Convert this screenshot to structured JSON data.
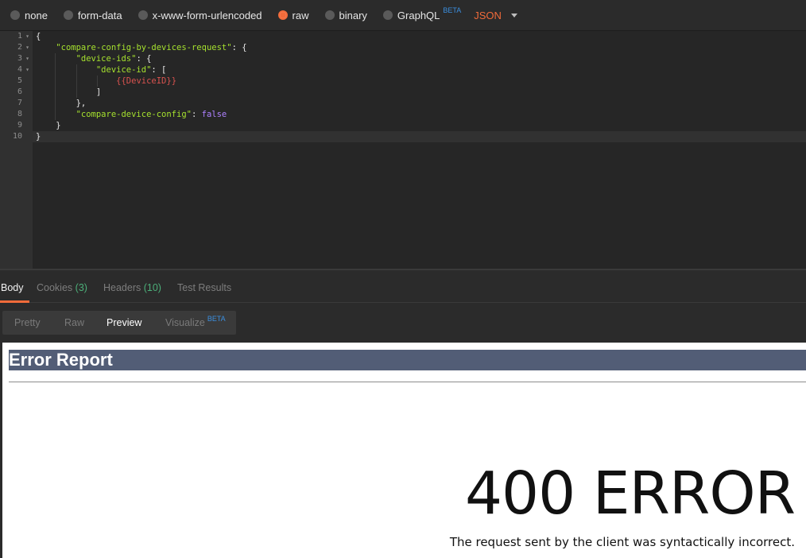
{
  "body_types": {
    "options": [
      {
        "label": "none",
        "selected": false
      },
      {
        "label": "form-data",
        "selected": false
      },
      {
        "label": "x-www-form-urlencoded",
        "selected": false
      },
      {
        "label": "raw",
        "selected": true
      },
      {
        "label": "binary",
        "selected": false
      },
      {
        "label": "GraphQL",
        "selected": false,
        "badge": "BETA"
      }
    ],
    "format": "JSON"
  },
  "editor": {
    "line_numbers": [
      "1",
      "2",
      "3",
      "4",
      "5",
      "6",
      "7",
      "8",
      "9",
      "10"
    ],
    "lines": [
      {
        "indent": "",
        "parts": [
          {
            "t": "plain",
            "v": "{"
          }
        ]
      },
      {
        "indent": "    ",
        "parts": [
          {
            "t": "key",
            "v": "\"compare-config-by-devices-request\""
          },
          {
            "t": "plain",
            "v": ": {"
          }
        ]
      },
      {
        "indent": "        ",
        "parts": [
          {
            "t": "key",
            "v": "\"device-ids\""
          },
          {
            "t": "plain",
            "v": ": {"
          }
        ]
      },
      {
        "indent": "            ",
        "parts": [
          {
            "t": "key",
            "v": "\"device-id\""
          },
          {
            "t": "plain",
            "v": ": ["
          }
        ]
      },
      {
        "indent": "                ",
        "parts": [
          {
            "t": "var",
            "v": "{{DeviceID}}"
          }
        ]
      },
      {
        "indent": "            ",
        "parts": [
          {
            "t": "plain",
            "v": "]"
          }
        ]
      },
      {
        "indent": "        ",
        "parts": [
          {
            "t": "plain",
            "v": "},"
          }
        ]
      },
      {
        "indent": "        ",
        "parts": [
          {
            "t": "key",
            "v": "\"compare-device-config\""
          },
          {
            "t": "plain",
            "v": ": "
          },
          {
            "t": "bool",
            "v": "false"
          }
        ]
      },
      {
        "indent": "    ",
        "parts": [
          {
            "t": "plain",
            "v": "}"
          }
        ]
      },
      {
        "indent": "",
        "parts": [
          {
            "t": "plain",
            "v": "}"
          }
        ]
      }
    ]
  },
  "response": {
    "tabs": [
      {
        "label": "Body",
        "count": ""
      },
      {
        "label": "Cookies",
        "count": "(3)"
      },
      {
        "label": "Headers",
        "count": "(10)"
      },
      {
        "label": "Test Results",
        "count": ""
      }
    ],
    "views": [
      {
        "label": "Pretty"
      },
      {
        "label": "Raw"
      },
      {
        "label": "Preview"
      },
      {
        "label": "Visualize",
        "badge": "BETA"
      }
    ],
    "active_view": "Preview"
  },
  "preview": {
    "heading": "Error Report",
    "code": "400 ERROR",
    "message": "The request sent by the client was syntactically incorrect."
  },
  "colors": {
    "accent": "#f26b3a",
    "json_key": "#a6e22e",
    "json_bool": "#ae81ff",
    "json_variable": "#d9534f",
    "count_badge": "#4caf79",
    "beta_badge": "#3b8fe0",
    "error_header_bg": "#525d76"
  }
}
